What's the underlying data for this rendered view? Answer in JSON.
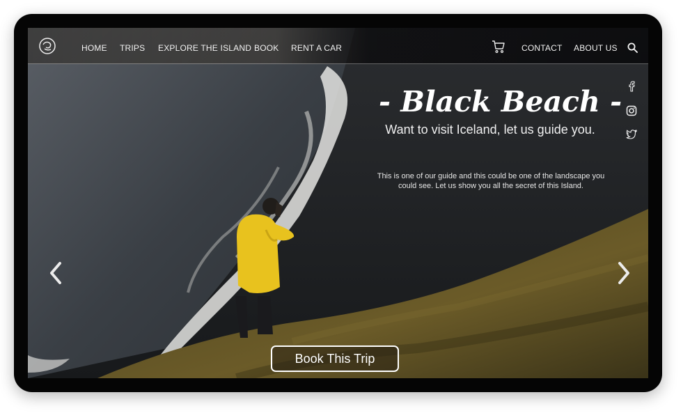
{
  "nav": {
    "logo": "iceland-spiral-logo-icon",
    "links": [
      "HOME",
      "TRIPS",
      "EXPLORE THE ISLAND",
      "BOOK",
      "RENT A CAR"
    ],
    "right_links": [
      "CONTACT",
      "ABOUT US"
    ],
    "cart_icon": "cart-icon",
    "search_icon": "search-icon"
  },
  "hero": {
    "title": "- Black Beach -",
    "subtitle": "Want to visit Iceland, let us guide you.",
    "description": "This is one of our guide and this could be one of the landscape you could see. Let us show you all the secret of this Island.",
    "cta_label": "Book This Trip"
  },
  "social": [
    "facebook-icon",
    "instagram-icon",
    "twitter-icon"
  ],
  "carousel": {
    "prev_icon": "chevron-left-icon",
    "next_icon": "chevron-right-icon"
  },
  "colors": {
    "jacket": "#e8c21e",
    "sea": "#3d4248",
    "black_sand": "#1e2124",
    "grass": "#5a4f24"
  }
}
